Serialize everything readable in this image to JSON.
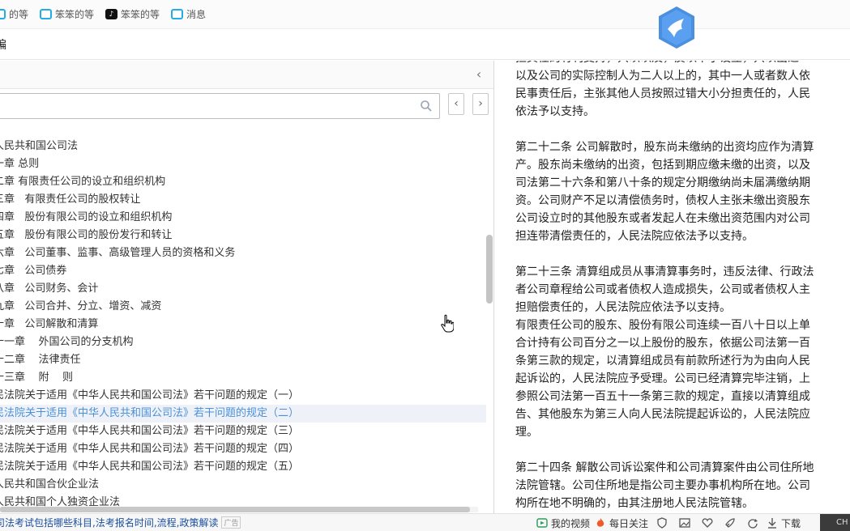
{
  "bookmarks": [
    {
      "label": "的等",
      "icon": "bilibili-icon"
    },
    {
      "label": "笨笨的等",
      "icon": "bilibili-icon"
    },
    {
      "label": "笨笨的等",
      "icon": "tiktok-icon"
    },
    {
      "label": "消息",
      "icon": "bilibili-icon"
    }
  ],
  "toolbar": {
    "label": "编"
  },
  "search": {
    "value": "",
    "placeholder": ""
  },
  "nav": {
    "prev": "‹",
    "next": "›",
    "collapse": "‹"
  },
  "tree": [
    {
      "label": "人民共和国公司法"
    },
    {
      "label": "一章 总则"
    },
    {
      "label": "二章 有限责任公司的设立和组织机构"
    },
    {
      "label": "三章   有限责任公司的股权转让"
    },
    {
      "label": "四章   股份有限公司的设立和组织机构"
    },
    {
      "label": "五章   股份有限公司的股份发行和转让"
    },
    {
      "label": "六章   公司董事、监事、高级管理人员的资格和义务"
    },
    {
      "label": "七章   公司债券"
    },
    {
      "label": "八章   公司财务、会计"
    },
    {
      "label": "九章   公司合并、分立、增资、减资"
    },
    {
      "label": "十章   公司解散和清算"
    },
    {
      "label": "十一章    外国公司的分支机构"
    },
    {
      "label": "十二章    法律责任"
    },
    {
      "label": "十三章    附    则"
    },
    {
      "label": "民法院关于适用《中华人民共和国公司法》若干问题的规定（一）"
    },
    {
      "label": "民法院关于适用《中华人民共和国公司法》若干问题的规定（二）",
      "selected": true
    },
    {
      "label": "民法院关于适用《中华人民共和国公司法》若干问题的规定（三）"
    },
    {
      "label": "民法院关于适用《中华人民共和国公司法》若干问题的规定（四）"
    },
    {
      "label": "民法院关于适用《中华人民共和国公司法》若干问题的规定（五）"
    },
    {
      "label": "人民共和国合伙企业法"
    },
    {
      "label": "人民共和国个人独资企业法"
    }
  ],
  "doc": {
    "paragraphs": [
      {
        "lines": [
          "担其任的有利支持，只以以及，反以下小设立，只以出之",
          "以及公司的实际控制人为二人以上的，其中一人或者数人依",
          "民事责任后，主张其他人员按照过错大小分担责任的，人民",
          "依法予以支持。"
        ]
      },
      {
        "lines": [
          "第二十二条  公司解散时，股东尚未缴纳的出资均应作为清算",
          "产。股东尚未缴纳的出资，包括到期应缴未缴的出资，以及",
          "司法第二十六条和第八十条的规定分期缴纳尚未届满缴纳期",
          "资。公司财产不足以清偿债务时，债权人主张未缴出资股东",
          "公司设立时的其他股东或者发起人在未缴出资范围内对公司",
          "担连带清偿责任的，人民法院应依法予以支持。"
        ]
      },
      {
        "lines": [
          "第二十三条  清算组成员从事清算事务时，违反法律、行政法",
          "者公司章程给公司或者债权人造成损失，公司或者债权人主",
          "担赔偿责任的，人民法院应依法予以支持。",
          "有限责任公司的股东、股份有限公司连续一百八十日以上单",
          "合计持有公司百分之一以上股份的股东，依据公司法第一百",
          "条第三款的规定，以清算组成员有前款所述行为为由向人民",
          "起诉讼的，人民法院应予受理。公司已经清算完毕注销，上",
          "参照公司法第一百五十一条第三款的规定，直接以清算组成",
          "告、其他股东为第三人向人民法院提起诉讼的，人民法院应",
          "理。"
        ]
      },
      {
        "lines": [
          "第二十四条  解散公司诉讼案件和公司清算案件由公司住所地",
          "法院管辖。公司住所地是指公司主要办事机构所在地。公司",
          "构所在地不明确的，由其注册地人民法院管辖。"
        ]
      }
    ]
  },
  "status": {
    "news": "司法考试包括哪些科目,法考报名时间,流程,政策解读",
    "news_tag": "广告",
    "my_video": "我的视频",
    "daily_focus": "每日关注",
    "download": "下载",
    "tray": "CH"
  },
  "colors": {
    "accent": "#4a90d9",
    "selected_bg": "#eef2f8",
    "bilibili": "#23ade5",
    "news_link": "#1a4fa0"
  }
}
